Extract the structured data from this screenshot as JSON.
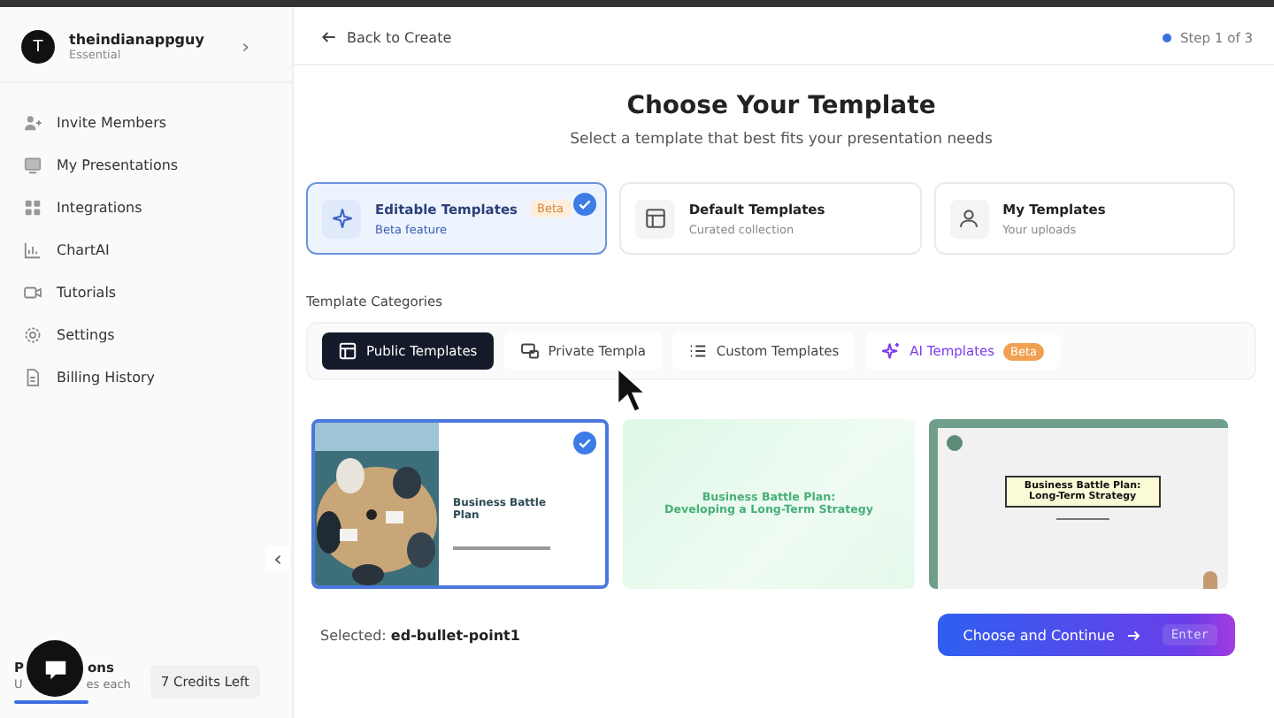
{
  "sidebar": {
    "user": {
      "initial": "T",
      "name": "theindianappguy",
      "plan": "Essential",
      "chevron": "›"
    },
    "items": [
      {
        "label": "Invite Members"
      },
      {
        "label": "My Presentations"
      },
      {
        "label": "Integrations"
      },
      {
        "label": "ChartAI"
      },
      {
        "label": "Tutorials"
      },
      {
        "label": "Settings"
      },
      {
        "label": "Billing History"
      }
    ],
    "plan": {
      "title_parts": [
        "P",
        "ons"
      ],
      "subtitle_parts": [
        "U",
        "es each"
      ]
    },
    "credits": "7 Credits Left",
    "collapse": "‹"
  },
  "header": {
    "back": "Back to Create",
    "step": "Step 1 of 3"
  },
  "title": "Choose Your Template",
  "subtitle": "Select a template that best fits your presentation needs",
  "template_types": [
    {
      "title": "Editable Templates",
      "badge": "Beta",
      "caption": "Beta feature",
      "selected": true
    },
    {
      "title": "Default Templates",
      "caption": "Curated collection",
      "selected": false
    },
    {
      "title": "My Templates",
      "caption": "Your uploads",
      "selected": false
    }
  ],
  "categories_label": "Template Categories",
  "categories": [
    {
      "label": "Public Templates",
      "kind": "standard",
      "selected": true
    },
    {
      "label": "Private Templa",
      "kind": "standard",
      "selected": false
    },
    {
      "label": "Custom Templates",
      "kind": "standard",
      "selected": false
    },
    {
      "label": "AI Templates",
      "kind": "ai",
      "badge": "Beta",
      "selected": false
    }
  ],
  "thumbnails": [
    {
      "kind": "photo-split",
      "lines": [
        "Business Battle",
        "Plan"
      ],
      "selected": true
    },
    {
      "kind": "green",
      "lines": [
        "Business Battle Plan:",
        "Developing a Long-Term Strategy"
      ],
      "selected": false
    },
    {
      "kind": "framed",
      "lines": [
        "Business Battle Plan:",
        "Long-Term Strategy"
      ],
      "selected": false
    }
  ],
  "footer": {
    "selected_label": "Selected:",
    "selected_value": "ed-bullet-point1",
    "button": "Choose and Continue",
    "shortcut": "Enter"
  }
}
